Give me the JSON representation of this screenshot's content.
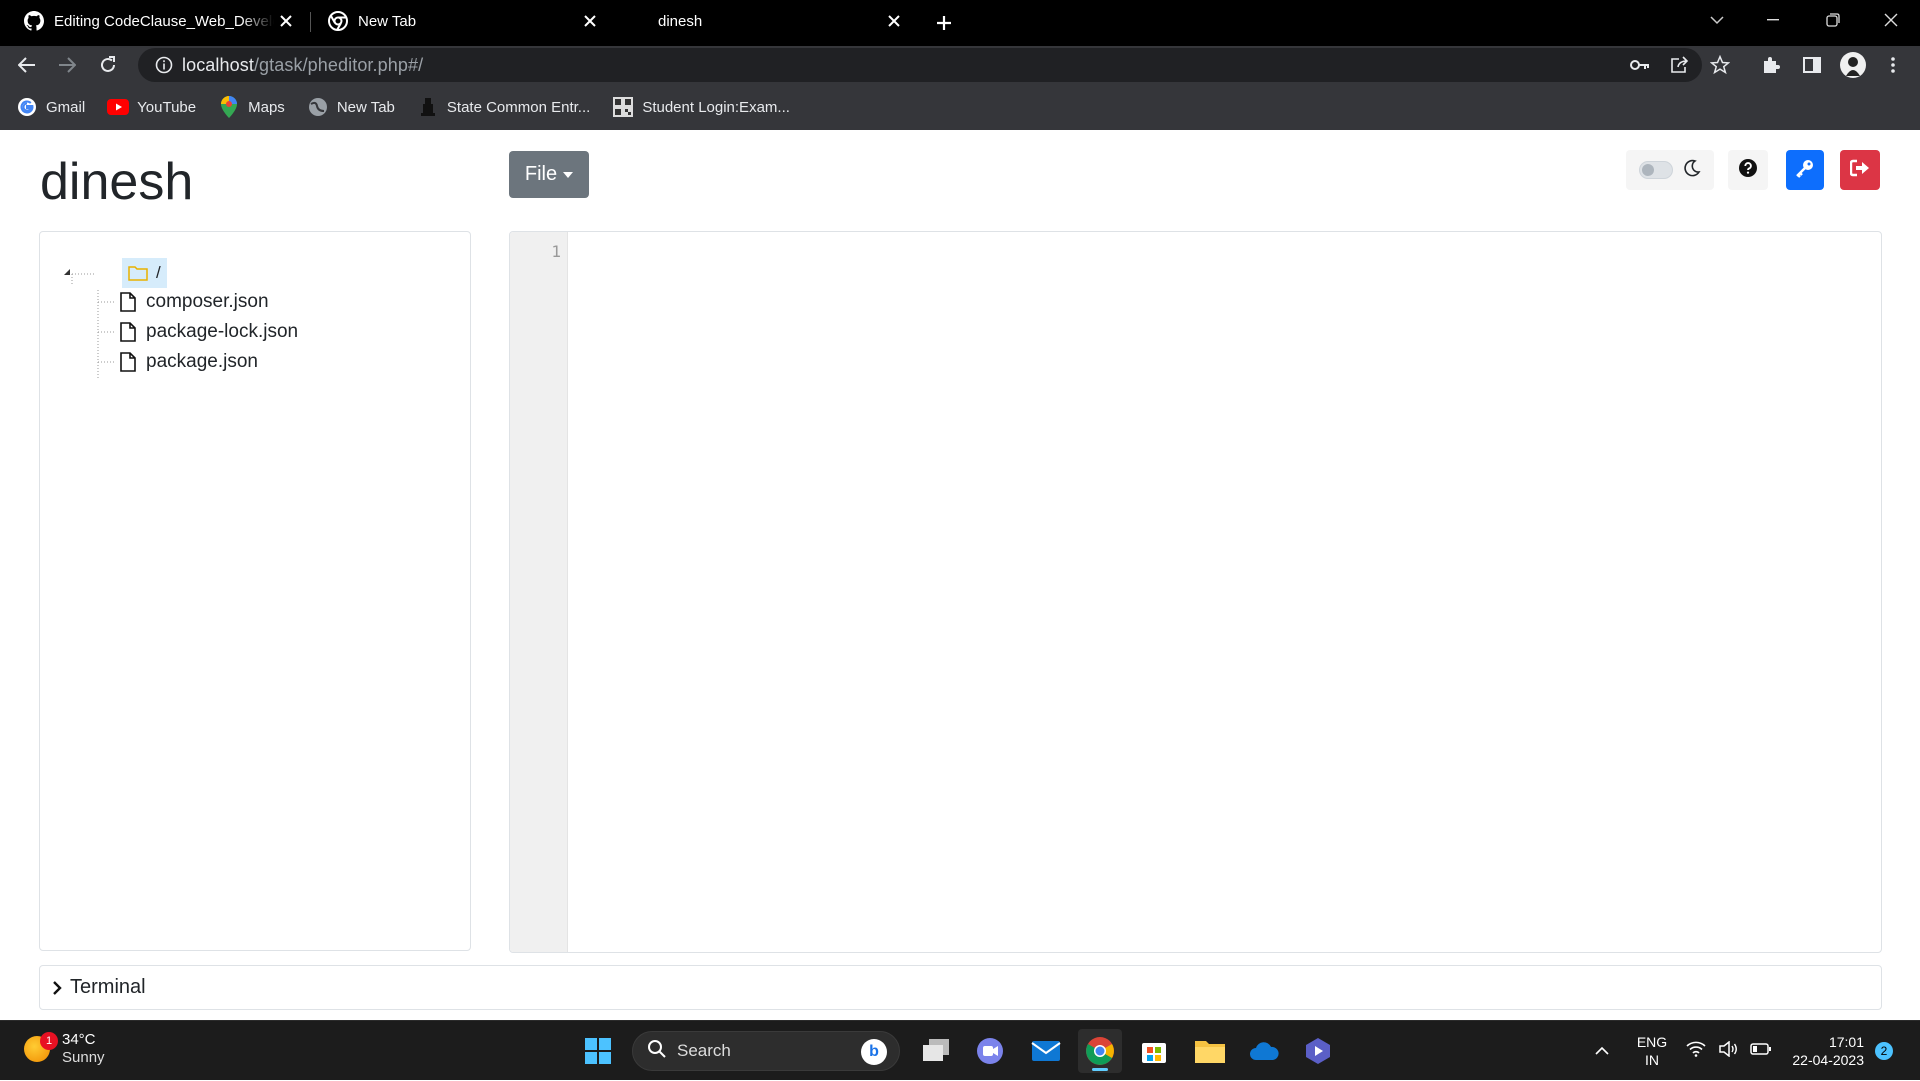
{
  "browser": {
    "tabs": [
      {
        "title": "Editing CodeClause_Web_Develo",
        "favicon": "github-icon"
      },
      {
        "title": "New Tab",
        "favicon": "chrome-icon"
      },
      {
        "title": "dinesh",
        "favicon": "none",
        "active": true
      }
    ],
    "url_host": "localhost",
    "url_path": "/gtask/pheditor.php#/",
    "bookmarks": [
      {
        "label": "Gmail",
        "icon": "google-icon"
      },
      {
        "label": "YouTube",
        "icon": "youtube-icon"
      },
      {
        "label": "Maps",
        "icon": "maps-pin-icon"
      },
      {
        "label": "New Tab",
        "icon": "globe-icon"
      },
      {
        "label": "State Common Entr...",
        "icon": "emblem-icon"
      },
      {
        "label": "Student Login:Exam...",
        "icon": "qr-icon"
      }
    ]
  },
  "app": {
    "title": "dinesh",
    "file_menu_label": "File",
    "tree": {
      "root_label": "/",
      "files": [
        "composer.json",
        "package-lock.json",
        "package.json"
      ]
    },
    "editor": {
      "line_numbers": [
        "1"
      ]
    },
    "terminal_label": "Terminal",
    "colors": {
      "primary": "#0d6efd",
      "danger": "#dc3545",
      "secondary": "#6c757d"
    }
  },
  "taskbar": {
    "weather_temp": "34°C",
    "weather_condition": "Sunny",
    "weather_badge": "1",
    "search_label": "Search",
    "lang_line1": "ENG",
    "lang_line2": "IN",
    "time": "17:01",
    "date": "22-04-2023",
    "notification_count": "2"
  }
}
